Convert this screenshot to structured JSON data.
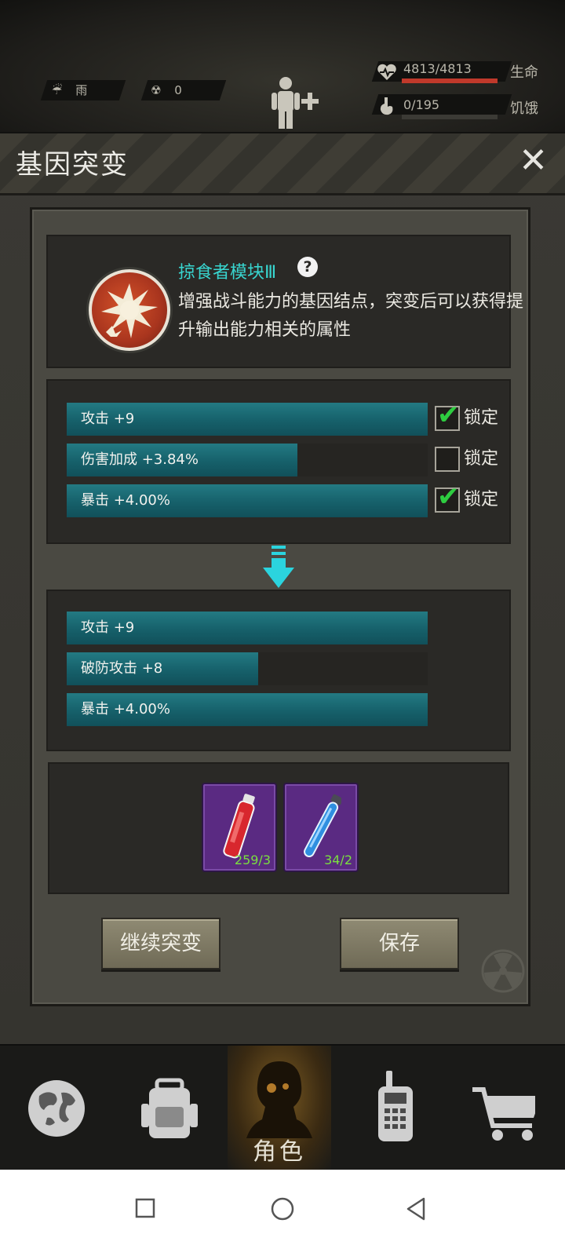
{
  "status": {
    "weather_label": "雨",
    "radiation_value": "0",
    "health": {
      "text": "4813/4813",
      "label": "生命",
      "fraction": 1.0
    },
    "hunger": {
      "text": "0/195",
      "label": "饥饿",
      "fraction": 0.0
    }
  },
  "modal": {
    "title": "基因突变",
    "close_glyph": "✕",
    "gene": {
      "name": "掠食者模块Ⅲ",
      "help_glyph": "?",
      "description": "增强战斗能力的基因结点，突变后可以获得提升输出能力相关的属性"
    },
    "current_attributes": [
      {
        "label": "攻击 +9",
        "fill": 1.0,
        "locked": true,
        "lock_label": "锁定"
      },
      {
        "label": "伤害加成 +3.84%",
        "fill": 0.64,
        "locked": false,
        "lock_label": "锁定"
      },
      {
        "label": "暴击 +4.00%",
        "fill": 1.0,
        "locked": true,
        "lock_label": "锁定"
      }
    ],
    "new_attributes": [
      {
        "label": "攻击 +9",
        "fill": 1.0
      },
      {
        "label": "破防攻击 +8",
        "fill": 0.53
      },
      {
        "label": "暴击 +4.00%",
        "fill": 1.0
      }
    ],
    "items": [
      {
        "icon": "red-vial-icon",
        "count": "259/3",
        "color": "#d8272e"
      },
      {
        "icon": "blue-tube-icon",
        "count": "34/2",
        "color": "#2f8fe0"
      }
    ],
    "continue_button": "继续突变",
    "save_button": "保存"
  },
  "nav": {
    "tabs": [
      {
        "icon": "globe-icon",
        "label": ""
      },
      {
        "icon": "backpack-icon",
        "label": ""
      },
      {
        "icon": "character-icon",
        "label": "角色",
        "active": true
      },
      {
        "icon": "radio-icon",
        "label": ""
      },
      {
        "icon": "cart-icon",
        "label": ""
      }
    ]
  },
  "colors": {
    "accent_teal": "#38d5cf",
    "health_red": "#c0392b",
    "check_green": "#2ecc40"
  }
}
